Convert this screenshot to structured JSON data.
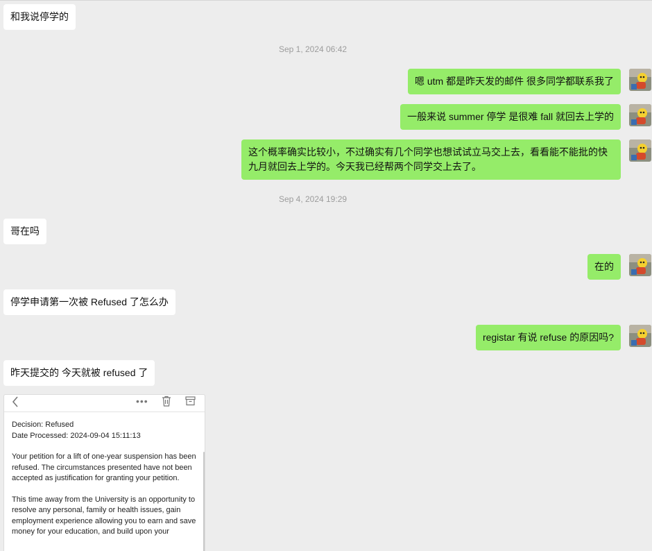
{
  "colors": {
    "background": "#ededed",
    "incoming_bubble": "#ffffff",
    "outgoing_bubble": "#95ec69",
    "timestamp": "#9c9c9c"
  },
  "messages": [
    {
      "side": "in",
      "text": "和我说停学的"
    },
    {
      "type": "timestamp",
      "text": "Sep 1, 2024 06:42"
    },
    {
      "side": "out",
      "text": "嗯 utm 都是昨天发的邮件 很多同学都联系我了"
    },
    {
      "side": "out",
      "text": "一般来说 summer 停学 是很难 fall 就回去上学的"
    },
    {
      "side": "out",
      "text": "这个概率确实比较小，不过确实有几个同学也想试试立马交上去，看看能不能批的快九月就回去上学的。今天我已经帮两个同学交上去了。"
    },
    {
      "type": "timestamp",
      "text": "Sep 4, 2024 19:29"
    },
    {
      "side": "in",
      "text": "哥在吗"
    },
    {
      "side": "out",
      "text": "在的"
    },
    {
      "side": "in",
      "text": "停学申请第一次被 Refused 了怎么办"
    },
    {
      "side": "out",
      "text": "registar 有说 refuse 的原因吗?"
    },
    {
      "side": "in",
      "text": "昨天提交的 今天就被 refused 了"
    }
  ],
  "email_screenshot": {
    "icons": [
      "back-chevron-icon",
      "more-icon",
      "trash-icon",
      "archive-icon"
    ],
    "decision_line": "Decision: Refused",
    "date_line": "Date Processed: 2024-09-04 15:11:13",
    "paragraph_1": "Your petition for a lift of one-year suspension has been refused. The circumstances presented have not been accepted as justification for granting your petition.",
    "paragraph_2": "This time away from the University is an opportunity to resolve any personal, family or health issues, gain employment experience allowing you to earn and save money for your education, and build upon your"
  }
}
